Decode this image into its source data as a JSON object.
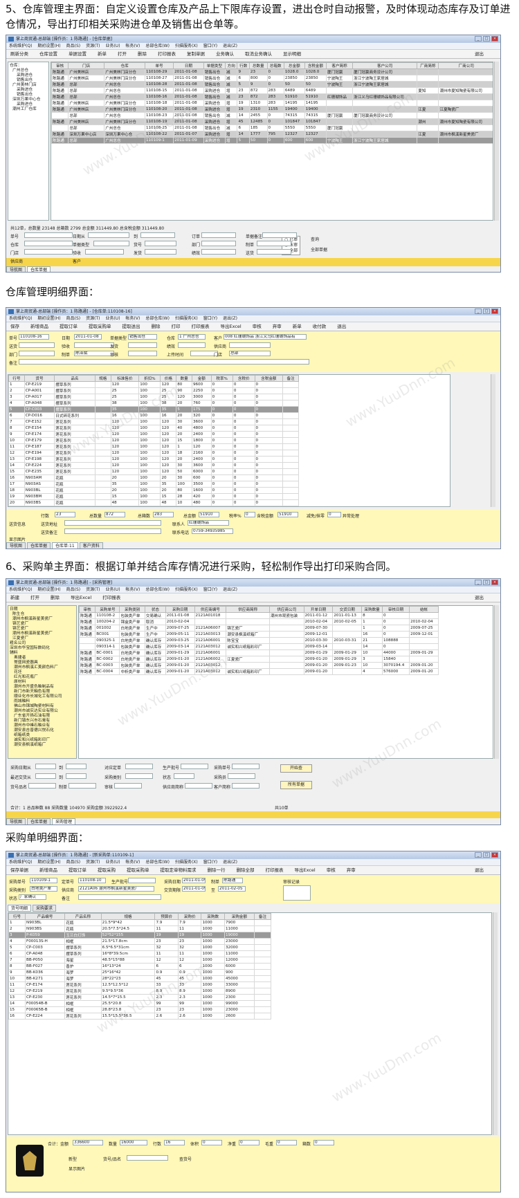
{
  "headings": {
    "h5": "5、仓库管理主界面：自定义设置仓库及产品上下限库存设置，进出仓时自动报警，及时体现动态库存及订单进仓情况，导出打印相关采购进仓单及销售出仓单等。",
    "h5b": "仓库管理明细界面：",
    "h6": "6、采购单主界面：根据订单并结合库存情况进行采购，轻松制作导出打印采购合同。",
    "h6b": "采购单明细界面："
  },
  "s1": {
    "title": "掌上商贸通-总部端 [操作员：1 陈路通] - [仓库单据]",
    "menu": [
      "系统维护(Q)",
      "期初设置(H)",
      "商品(S)",
      "资源(T)",
      "业务(U)",
      "帐务(V)",
      "总部仓库(W)",
      "扫描服务(X)",
      "窗口(Y)",
      "退出(Z)"
    ],
    "tools": [
      "刷新分类",
      "仓库设置",
      "单据设置",
      "新单",
      "打开",
      "删除",
      "打印报表",
      "复制单据",
      "业务确认",
      "取消业务确认",
      "显示明细"
    ],
    "exit": "退出",
    "tree": [
      "仓库：",
      "广州总仓",
      "采购进仓",
      "销售出仓",
      "广州美林门店",
      "采购进仓",
      "销售出仓",
      "深圳万果中心仓",
      "采购进仓",
      "潮州工厂仓库"
    ],
    "cols": [
      "审核",
      "门店",
      "仓库",
      "单号",
      "日期",
      "单据类型",
      "方向",
      "行数",
      "总数量",
      "总箱数",
      "总金额",
      "含税金额",
      "客户简称",
      "客户公司",
      "厂商简称",
      "厂商公司"
    ],
    "rows": [
      [
        "陈路通",
        "广州美林店",
        "广州美林门店分仓",
        "110108-29",
        "2011-01-08",
        "销售出仓",
        "减",
        "9",
        "23",
        "0",
        "1028.0",
        "1028.0",
        "厦门冠赢",
        "厦门冠赢商务设计公司",
        "",
        ""
      ],
      [
        "陈路通",
        "广州美林店",
        "广州美林门店分仓",
        "110108-27",
        "2011-01-08",
        "销售出仓",
        "减",
        "6",
        "800",
        "0",
        "23850",
        "23850",
        "宁波陶王",
        "浙江宁波陶王家居城",
        "",
        ""
      ],
      [
        "陈路通",
        "总部",
        "广州总仓",
        "110108-28",
        "2011-01-08",
        "销售出仓",
        "减",
        "5",
        "9",
        "0",
        "50",
        "50",
        "宁波陶王",
        "浙江宁波陶王家居城",
        "",
        ""
      ],
      [
        "陈路通",
        "总部",
        "广州总仓",
        "110108-15",
        "2011-01-08",
        "采购进仓",
        "增",
        "23",
        "872",
        "283",
        "6489",
        "6489",
        "",
        "",
        "夏知",
        "潮州市夏知陶瓷有限公司"
      ],
      [
        "陈路通",
        "总部",
        "广州总仓",
        "110108-16",
        "2011-01-08",
        "销售出仓",
        "减",
        "23",
        "872",
        "283",
        "51910",
        "51910",
        "红珊瑚饰品",
        "浙江义乌红珊瑚饰品有限公司",
        "",
        ""
      ],
      [
        "陈路通",
        "广州美林店",
        "广州美林门店分仓",
        "110108-18",
        "2011-01-08",
        "采购进仓",
        "增",
        "19",
        "1310",
        "283",
        "14195",
        "14195",
        "",
        "",
        "",
        ""
      ],
      [
        "陈路通",
        "广州美林店",
        "广州美林门店分仓",
        "110108-20",
        "2011-01-08",
        "采购进仓",
        "增",
        "19",
        "2310",
        "1155",
        "19400",
        "19400",
        "",
        "",
        "江夏",
        "江夏陶瓷厂"
      ],
      [
        "",
        "总部",
        "广州总仓",
        "110108-23",
        "2011-01-08",
        "销售出仓",
        "减",
        "14",
        "2455",
        "0",
        "74315",
        "74315",
        "厦门冠赢",
        "厦门冠赢商务设计公司",
        "",
        ""
      ],
      [
        "陈路通",
        "广州美林店",
        "广州美林门店分仓",
        "110108-19",
        "2011-01-08",
        "采购进仓",
        "增",
        "45",
        "12485",
        "0",
        "101847",
        "101847",
        "",
        "",
        "潮州",
        "潮州市夏知陶瓷有限公司"
      ],
      [
        "",
        "总部",
        "广州总仓",
        "110108-25",
        "2011-01-08",
        "销售出仓",
        "减",
        "6",
        "185",
        "0",
        "5550",
        "5550",
        "厦门冠赢",
        "",
        "",
        ""
      ],
      [
        "陈路通",
        "深圳万果中心店",
        "深圳万果中心仓",
        "110108-22",
        "2011-01-07",
        "采购进仓",
        "增",
        "14",
        "1777",
        "795",
        "12327",
        "12327",
        "",
        "",
        "江夏",
        "潮州市枫溪新星美瓷厂"
      ],
      [
        "陈路通",
        "总部",
        "广州总仓",
        "110109-1",
        "2011-01-09",
        "采购进仓",
        "增",
        "5",
        "50",
        "0",
        "600",
        "600",
        "宁波陶王",
        "浙江宁波陶王家居城",
        "",
        ""
      ]
    ],
    "summary": "共12单，总数量 23148 总箱数 2799 总金额 311449.80 总含税金额 311449.80",
    "filters": [
      "单号",
      "日期从",
      "到",
      "订单",
      "单据备注",
      "仓库",
      "单据类型",
      "货号",
      "部门",
      "制单",
      "门店",
      "验收",
      "发货",
      "绩效",
      "送货",
      "供应商",
      "客户"
    ],
    "radios": [
      "已审",
      "未审",
      "全部"
    ],
    "query": "查询",
    "allbills": "全部单据",
    "tabs": [
      "导航图",
      "仓库单据"
    ]
  },
  "s2": {
    "title": "掌上商贸通-总部端 [操作员：1 陈路通] - [仓库单:110108-16]",
    "menu": [
      "系统维护(Q)",
      "期初设置(H)",
      "商品(S)",
      "资源(T)",
      "业务(U)",
      "帐务(V)",
      "总部仓库(W)",
      "扫描服务(X)",
      "窗口(Y)",
      "退出(Z)"
    ],
    "tools": [
      "保存",
      "新增商品",
      "提取订单",
      "提取采购单",
      "提取送出",
      "删除",
      "打印",
      "打印报表",
      "导出Excel",
      "审核",
      "弃审",
      "新单",
      "收付款",
      "退出"
    ],
    "fields": {
      "no_l": "单号",
      "no": "110108-16",
      "date_l": "日期",
      "date": "2011-01-08",
      "type_l": "单据类型",
      "type": "销售出仓",
      "wh_l": "仓库",
      "wh": "1 广州总仓",
      "cust_l": "客户",
      "cust": "008 红珊瑚饰品 浙江义乌红珊瑚饰品有",
      "deliv_l": "送货",
      "check_l": "验收",
      "ship_l": "发货",
      "perf_l": "绩效",
      "supp_l": "供应商",
      "dept_l": "部门",
      "maker_l": "制单",
      "maker": "陈泽斌",
      "audit_l": "审核",
      "upload_l": "上传时间",
      "store_l": "门店",
      "store": "总部",
      "note_l": "备注"
    },
    "cols": [
      "行号",
      "货号",
      "品名",
      "规格",
      "标准售价",
      "折扣%",
      "价格",
      "数量",
      "金额",
      "税率%",
      "含税价",
      "含税金额",
      "备注"
    ],
    "rows": [
      [
        "1",
        "CP-E219",
        "摆草系列",
        "",
        "120",
        "100",
        "120",
        "80",
        "9600",
        "0",
        "0",
        "0",
        ""
      ],
      [
        "2",
        "CP-A001",
        "摆草系列",
        "",
        "25",
        "100",
        "25",
        "90",
        "2250",
        "0",
        "0",
        "0",
        ""
      ],
      [
        "3",
        "CP-A017",
        "摆草系列",
        "",
        "25",
        "100",
        "25",
        "120",
        "3000",
        "0",
        "0",
        "0",
        ""
      ],
      [
        "4",
        "CP-A048",
        "摆草系列",
        "",
        "38",
        "100",
        "38",
        "20",
        "760",
        "0",
        "0",
        "0",
        ""
      ],
      [
        "5",
        "CP-C003",
        "摆草系列",
        "",
        "35",
        "100",
        "35",
        "5",
        "175",
        "0",
        "0",
        "0",
        ""
      ],
      [
        "6",
        "CP-D016",
        "日式碎花系列",
        "",
        "16",
        "100",
        "16",
        "20",
        "320",
        "0",
        "0",
        "0",
        ""
      ],
      [
        "7",
        "CP-E152",
        "莲花系列",
        "",
        "120",
        "100",
        "120",
        "30",
        "3600",
        "0",
        "0",
        "0",
        ""
      ],
      [
        "8",
        "CP-E154",
        "莲花系列",
        "",
        "120",
        "100",
        "120",
        "40",
        "4800",
        "0",
        "0",
        "0",
        ""
      ],
      [
        "9",
        "CP-E174",
        "莲花系列",
        "",
        "120",
        "100",
        "120",
        "20",
        "2400",
        "0",
        "0",
        "0",
        ""
      ],
      [
        "10",
        "CP-E179",
        "莲花系列",
        "",
        "120",
        "100",
        "120",
        "15",
        "1800",
        "0",
        "0",
        "0",
        ""
      ],
      [
        "11",
        "CP-E187",
        "莲花系列",
        "",
        "120",
        "100",
        "120",
        "1",
        "120",
        "0",
        "0",
        "0",
        ""
      ],
      [
        "12",
        "CP-E194",
        "莲花系列",
        "",
        "120",
        "100",
        "120",
        "18",
        "2160",
        "0",
        "0",
        "0",
        ""
      ],
      [
        "13",
        "CP-E198",
        "莲花系列",
        "",
        "120",
        "100",
        "120",
        "20",
        "2400",
        "0",
        "0",
        "0",
        ""
      ],
      [
        "14",
        "CP-E224",
        "莲花系列",
        "",
        "120",
        "100",
        "120",
        "30",
        "3600",
        "0",
        "0",
        "0",
        ""
      ],
      [
        "15",
        "CP-E235",
        "莲花系列",
        "",
        "120",
        "100",
        "120",
        "50",
        "6000",
        "0",
        "0",
        "0",
        ""
      ],
      [
        "16",
        "N903AM",
        "花瓶",
        "",
        "20",
        "100",
        "20",
        "30",
        "600",
        "0",
        "0",
        "0",
        ""
      ],
      [
        "17",
        "N903AS",
        "花瓶",
        "",
        "35",
        "100",
        "35",
        "100",
        "3500",
        "0",
        "0",
        "0",
        ""
      ],
      [
        "18",
        "N903BL",
        "花瓶",
        "",
        "20",
        "100",
        "20",
        "80",
        "1600",
        "0",
        "0",
        "0",
        ""
      ],
      [
        "19",
        "N903BM",
        "花瓶",
        "",
        "15",
        "100",
        "15",
        "28",
        "420",
        "0",
        "0",
        "0",
        ""
      ],
      [
        "20",
        "N903BS",
        "花瓶",
        "",
        "48",
        "100",
        "48",
        "10",
        "480",
        "0",
        "0",
        "0",
        ""
      ],
      [
        "21",
        "N903C",
        "花瓶",
        "",
        "25",
        "100",
        "25",
        "5",
        "125",
        "0",
        "0",
        "0",
        ""
      ],
      [
        "22",
        "N903D",
        "花瓶",
        "",
        "25",
        "100",
        "25",
        "20",
        "500",
        "0",
        "0",
        "0",
        ""
      ],
      [
        "23",
        "N903F",
        "花瓶",
        "",
        "38",
        "100",
        "38",
        "50",
        "1900",
        "0",
        "0",
        "0",
        ""
      ]
    ],
    "totals": {
      "rows_l": "行数",
      "rows": "23",
      "qty_l": "总数量",
      "qty": "872",
      "box_l": "总箱数",
      "box": "283",
      "amt_l": "总金额",
      "amt": "51910",
      "tax_l": "税率%",
      "tax": "0",
      "taxamt_l": "含税金额",
      "taxamt": "51910",
      "disc_l": "减免/抹零",
      "disc": "0",
      "settle": "异常处理"
    },
    "addr": {
      "addr_chk": "送货信息",
      "addr_l": "送货地址",
      "note_l": "送货备注",
      "contact_l": "联系人",
      "contact": "红珊瑚饰品",
      "tel_l": "联系电话",
      "tel": "0759-34935985",
      "img": "显示图片"
    },
    "tabs": [
      "导航图",
      "仓库单据",
      "仓库单:11",
      "客户资料"
    ]
  },
  "s3": {
    "title": "掌上商贸通-总部端 [操作员：1 陈路通] - [采购管理]",
    "menu": [
      "系统维护(Q)",
      "期初设置(H)",
      "商品(S)",
      "资源(T)",
      "业务(U)",
      "帐务(V)",
      "总部仓库(W)",
      "扫描服务(X)",
      "窗口(Y)",
      "退出(Z)"
    ],
    "tools": [
      "新建",
      "打开",
      "删除",
      "导出Excel",
      "打印报表"
    ],
    "exit": "退出",
    "tree": [
      "日期",
      "陈生仓",
      "潮州市枫溪新星美瓷厂",
      "锦艺瓷厂",
      "锦艺瓷厂",
      "潮州市枫溪新星美瓷厂",
      "江夏瓷厂",
      "粗名公司",
      "深圳市华宝国际数码化",
      "辅料",
      "奥捷者",
      "常盛网瓷器具",
      "潮州市枫溪汇美颜色料厂",
      "花坯",
      "红光和花瓶厂",
      "原材料",
      "潮州市开盛色釉制品有",
      "新门市新天釉色有限",
      "顺业化市长城化工有限公司",
      "雨城釉料",
      "佛山市锦城陶瓷材料有",
      "潮州市诚实达实业有限公",
      "广东省开扬石油有限",
      "新门镇东兴市石膏有",
      "潮州市中峰石釉业有",
      "潮安县吉普德兴悦石化",
      "纸箱纸类",
      "诚实和兴纸箱彩印厂",
      "潮安县枫溪纸箱厂"
    ],
    "cols": [
      "审核",
      "采购单号",
      "采购类别",
      "状态",
      "采购日期",
      "供应商编号",
      "供应商简称",
      "供应商公司",
      "开单日期",
      "交货日期",
      "采购数量",
      "审核日期",
      "结帐"
    ],
    "rows": [
      [
        "陈路通",
        "110108-2",
        "包装类产单",
        "交易确认",
        "2011-01-08",
        "2121A01018",
        "",
        "潮州市观瓷包装",
        "2011-01-12",
        "2011-01-13",
        "8",
        "0",
        ""
      ],
      [
        "陈路通",
        "100204-2",
        "锦盒类产单",
        "取消",
        "2010-02-04",
        "",
        "",
        "",
        "2010-02-04",
        "2010-02-05",
        "1",
        "0",
        "2010-02-04"
      ],
      [
        "陈路通",
        "001002",
        "白地类产单",
        "生产中",
        "2009-07-25",
        "2121A06007",
        "锦艺瓷厂",
        "",
        "2009-07-30",
        "",
        "1",
        "0",
        "2009-07-25"
      ],
      [
        "陈路通",
        "BC001",
        "包装类产单",
        "生产中",
        "2009-05-11",
        "2121A03013",
        "潮安县枫溪纸箱厂",
        "",
        "2009-12-01",
        "",
        "16",
        "0",
        "2009-12-01"
      ],
      [
        "",
        "090325-1",
        "白地类产单",
        "确认库存",
        "2009-03-25",
        "2121A06001",
        "陈宝宝",
        "",
        "2010-03-30",
        "2010-03-31",
        "21",
        "108888",
        ""
      ],
      [
        "",
        "090314-1",
        "包装类产单",
        "确认库存",
        "2009-03-14",
        "2121A03012",
        "诚实和兴纸箱彩印厂",
        "",
        "2009-03-14",
        "",
        "14",
        "0",
        ""
      ],
      [
        "陈路通",
        "BC-0001",
        "白地类产单",
        "确认库存",
        "2009-01-29",
        "2121A06001",
        "",
        "",
        "2009-01-29",
        "2009-01-29",
        "10",
        "44000",
        "2009-01-29"
      ],
      [
        "陈路通",
        "BC-0002",
        "白地类产单",
        "确认库存",
        "2009-01-20",
        "2121A06002",
        "江夏瓷厂",
        "",
        "2009-01-20",
        "2009-01-29",
        "3",
        "15840",
        ""
      ],
      [
        "陈路通",
        "BC-0003",
        "包装类产单",
        "确认库存",
        "2009-01-20",
        "2121A03012",
        "",
        "",
        "2009-01-20",
        "2009-01-23",
        "10",
        "3070194.4",
        "2009-01-20"
      ],
      [
        "陈路通",
        "BC-0004",
        "中析类产单",
        "确认库存",
        "2009-01-20",
        "2121A03012",
        "诚实和兴纸箱彩印厂",
        "",
        "2009-01-20",
        "",
        "4",
        "576000",
        "2009-01-20"
      ]
    ],
    "filters": [
      "采购日期从",
      "到",
      "对应定单",
      "生产批号",
      "采购单号",
      "最迟交货从",
      "到",
      "采购类别",
      "状态",
      "采购员",
      "货号品名",
      "制单",
      "审核",
      "供应商简称",
      "客户简称"
    ],
    "btns": [
      "开始查",
      "所有单据"
    ],
    "summary": "合计：1 总品种数 88 采购数量 104970 采购金额 3922922.4",
    "count": "共10单",
    "tabs": [
      "导航图",
      "仓库单据",
      "采购管理"
    ]
  },
  "s4": {
    "title": "掌上商贸通-总部端 [操作员：1 陈路通] - [新采购单:110109-1]",
    "menu": [
      "系统维护(Q)",
      "期初设置(H)",
      "商品(S)",
      "资源(T)",
      "业务(U)",
      "帐务(V)",
      "总部仓库(W)",
      "扫描服务(X)",
      "窗口(Y)",
      "退出(Z)"
    ],
    "tools": [
      "保存单据",
      "新增商品",
      "提取订单",
      "提取采购",
      "提取采购单",
      "提取定单物料需求",
      "删除一行",
      "删除全部",
      "打印报表",
      "导出Excel",
      "审核",
      "弃审"
    ],
    "exit": "退出",
    "fields": {
      "no_l": "采购单号",
      "no": "110109-1",
      "order_l": "定单号",
      "order": "110108-10",
      "batch_l": "生产批号",
      "date_l": "采购日期",
      "date": "2011-01-09",
      "maker_l": "制单",
      "maker": "陈路通",
      "audit": "审核记录",
      "cat_l": "采购类别",
      "cat": "白地类产单",
      "supp_l": "供应商",
      "supp": "2121A06 潮州市枫溪新星美瓷厂",
      "deliv_l": "交货期限",
      "deliv": "2011-01-09",
      "to_l": "至",
      "to": "2011-02-05",
      "status_l": "状态",
      "status": "厂家确认",
      "note_l": "备注"
    },
    "subtabs": [
      "货号明细",
      "采购要求"
    ],
    "cols": [
      "行号",
      "产品编号",
      "产品名称",
      "规格",
      "预算价",
      "采购价",
      "采购数",
      "采购金额",
      "备注"
    ],
    "rows": [
      [
        "1",
        "N903BL",
        "花瓶",
        "21.5*9*42",
        "7.9",
        "7.9",
        "1000",
        "7900",
        ""
      ],
      [
        "2",
        "N903BS",
        "花瓶",
        "20.5*7.5*24.5",
        "11",
        "11",
        "1000",
        "11000",
        ""
      ],
      [
        "3",
        "P-K059",
        "玉兰白灯饰",
        "52*52*155",
        "19",
        "19",
        "1000",
        "19000",
        ""
      ],
      [
        "4",
        "F00013S-H",
        "相框",
        "21.5*17.8cm",
        "23",
        "23",
        "1000",
        "23000",
        ""
      ],
      [
        "5",
        "CP-C003",
        "摆草系列",
        "6.5*6.5*31cm",
        "32",
        "32",
        "1000",
        "32000",
        ""
      ],
      [
        "6",
        "CP-A048",
        "摆草系列",
        "16*8*39.5cm",
        "11",
        "11",
        "1000",
        "11000",
        ""
      ],
      [
        "7",
        "BB-P050",
        "海星",
        "48.5*15*88",
        "12",
        "12",
        "1000",
        "12000",
        ""
      ],
      [
        "8",
        "BB-F027",
        "香炉",
        "16*13*24",
        "6",
        "6",
        "1000",
        "6000",
        ""
      ],
      [
        "9",
        "BB-K036",
        "海罗",
        "25*16*42",
        "0.9",
        "0.9",
        "1000",
        "900",
        ""
      ],
      [
        "10",
        "BB-K271",
        "海罗",
        "28*22*23",
        "45",
        "45",
        "1000",
        "45000",
        ""
      ],
      [
        "11",
        "CP-E174",
        "莲花系列",
        "12.5*12.5*12",
        "33",
        "33",
        "1000",
        "33000",
        ""
      ],
      [
        "12",
        "CP-E219",
        "莲花系列",
        "9.5*9.5*36",
        "8.9",
        "8.9",
        "1000",
        "8900",
        ""
      ],
      [
        "13",
        "CP-E230",
        "莲花系列",
        "14.5*7*15.5",
        "2.3",
        "2.3",
        "1000",
        "2300",
        ""
      ],
      [
        "14",
        "F00054B-B",
        "相框",
        "25.5*20.8",
        "99",
        "99",
        "1000",
        "99000",
        ""
      ],
      [
        "15",
        "F00065B-B",
        "相框",
        "28.8*23.8",
        "23",
        "23",
        "1000",
        "23000",
        ""
      ],
      [
        "16",
        "CP-E224",
        "莲花系列",
        "15.5*15.5*36.5",
        "2.6",
        "2.6",
        "1000",
        "2600",
        ""
      ]
    ],
    "totals": {
      "sum_l": "合计：金额",
      "sum": "336600",
      "qty_l": "数量",
      "qty": "16000",
      "rows_l": "行数",
      "rows": "16",
      "vol_l": "体积",
      "vol": "0",
      "net_l": "净重",
      "net": "0",
      "gross_l": "毛重",
      "gross": "0",
      "box_l": "箱数",
      "box": "0"
    },
    "new": "新型",
    "code_l": "货号/品名",
    "code_btn": "查货号",
    "img": "显示图片"
  }
}
